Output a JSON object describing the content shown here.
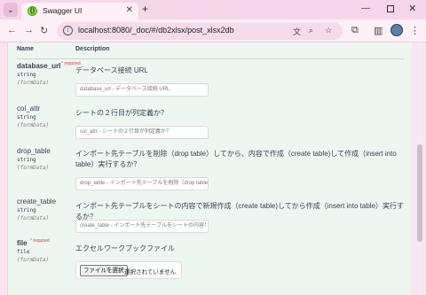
{
  "browser": {
    "tab_menu_icon": "chevron-down",
    "tab_title": "Swagger UI",
    "tab_close": "✕",
    "new_tab": "+",
    "url": "localhost:8080/_doc/#/db2xlsx/post_xlsx2db",
    "window_minimize": "—",
    "window_close": "✕"
  },
  "table": {
    "name_header": "Name",
    "description_header": "Description"
  },
  "params": [
    {
      "name": "database_url",
      "required": "* required",
      "type": "string",
      "in": "(formData)",
      "description": "データベース接続 URL",
      "placeholder": "database_url - データベース接続 URL"
    },
    {
      "name": "col_attr",
      "required": "",
      "type": "string",
      "in": "(formData)",
      "description": "シートの２行目が列定義か？",
      "placeholder": "col_attr - シートの２行目が列定義か？"
    },
    {
      "name": "drop_table",
      "required": "",
      "type": "string",
      "in": "(formData)",
      "description": "インポート先テーブルを削除（drop table）してから、内容で作成（create table)して作成（insert into table）実行するか？",
      "placeholder": "drop_table - インポート先テーブルを削除（drop table"
    },
    {
      "name": "create_table",
      "required": "",
      "type": "string",
      "in": "(formData)",
      "description": "インポート先テーブルをシートの内容で新規作成（create table)してから作成（insert into table）実行するか？",
      "placeholder": "create_table - インポート先テーブルをシートの内容！"
    },
    {
      "name": "file",
      "required": "* required",
      "type": "file",
      "in": "(formData)",
      "description": "エクセルワークブックファイル",
      "file_button": "ファイルを選択",
      "file_status": "選択されていません"
    }
  ],
  "colors": {
    "panel": "#eef6f1",
    "chrome": "#fbe3f0",
    "required": "#e53935"
  }
}
